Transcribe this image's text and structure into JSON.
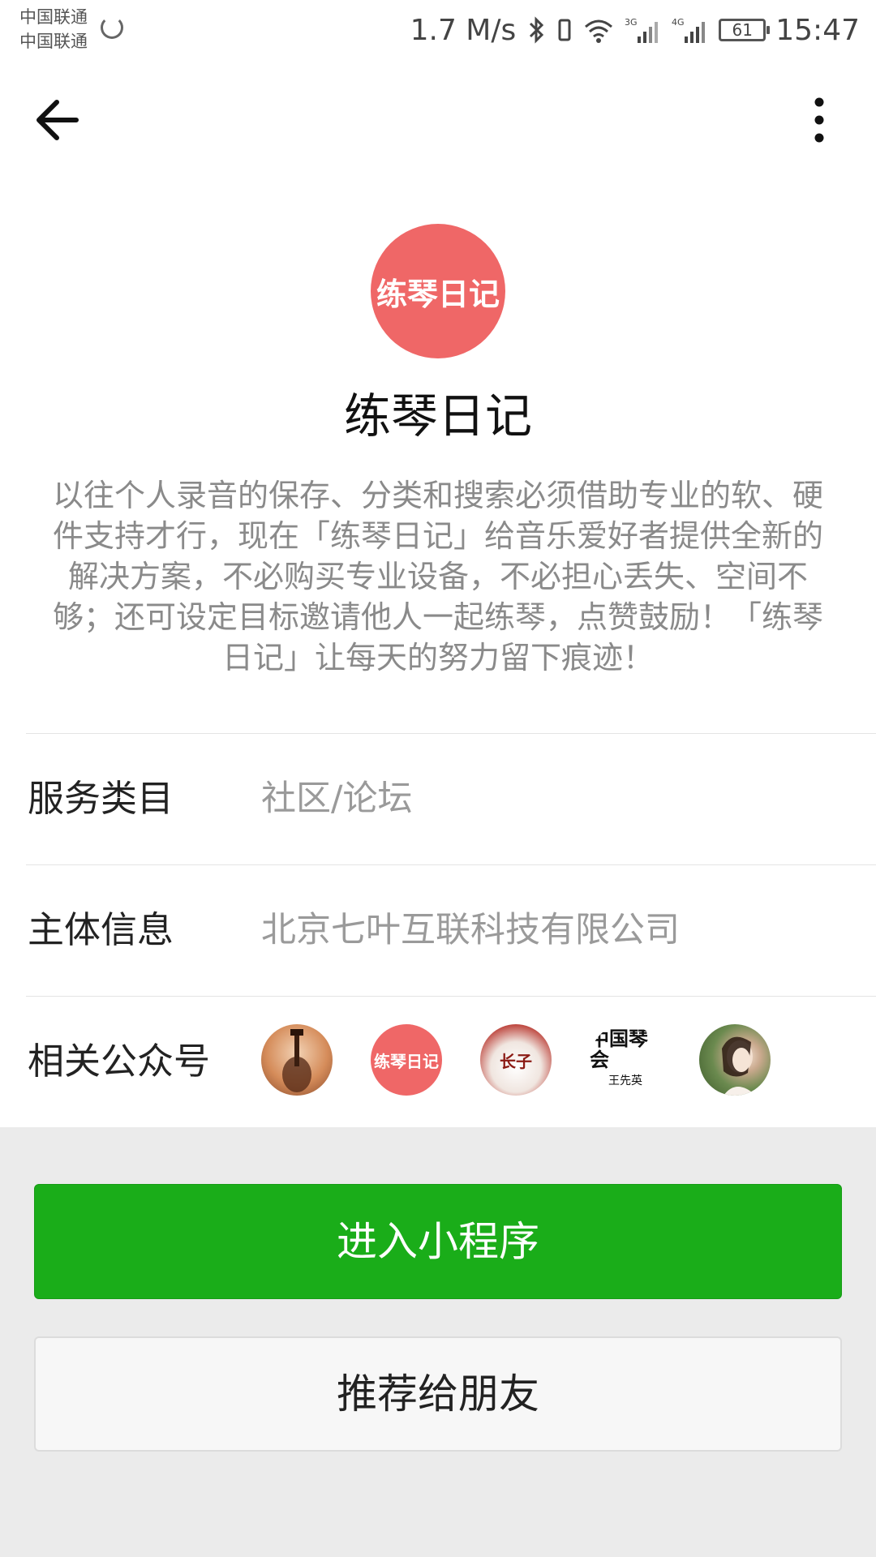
{
  "status_bar": {
    "carrier_1": "中国联通",
    "carrier_2": "中国联通",
    "network_speed": "1.7 M/s",
    "signal_1_label": "3G",
    "signal_2_label": "4G",
    "battery_level": "61",
    "time": "15:47"
  },
  "nav": {
    "back_icon": "back-arrow-icon",
    "more_icon": "more-vertical-icon"
  },
  "profile": {
    "logo_text": "练琴日记",
    "logo_color": "#ef6767",
    "name": "练琴日记",
    "description": "以往个人录音的保存、分类和搜索必须借助专业的软、硬件支持才行，现在「练琴日记」给音乐爱好者提供全新的解决方案，不必购买专业设备，不必担心丢失、空间不够；还可设定目标邀请他人一起练琴，点赞鼓励！「练琴日记」让每天的努力留下痕迹！"
  },
  "info": {
    "service_category_label": "服务类目",
    "service_category_value": "社区/论坛",
    "entity_label": "主体信息",
    "entity_value": "北京七叶互联科技有限公司",
    "related_accounts_label": "相关公众号",
    "related_accounts": [
      {
        "name": "account-avatar-guitar",
        "text": ""
      },
      {
        "name": "account-avatar-lianqin",
        "text": "练琴日记"
      },
      {
        "name": "account-avatar-changzi",
        "text": "长子"
      },
      {
        "name": "account-avatar-zhongguo-qinhui",
        "text": "中国琴会",
        "subtext": "王先英"
      },
      {
        "name": "account-avatar-girl",
        "text": ""
      }
    ]
  },
  "actions": {
    "enter_label": "进入小程序",
    "enter_color": "#1aad19",
    "share_label": "推荐给朋友"
  }
}
